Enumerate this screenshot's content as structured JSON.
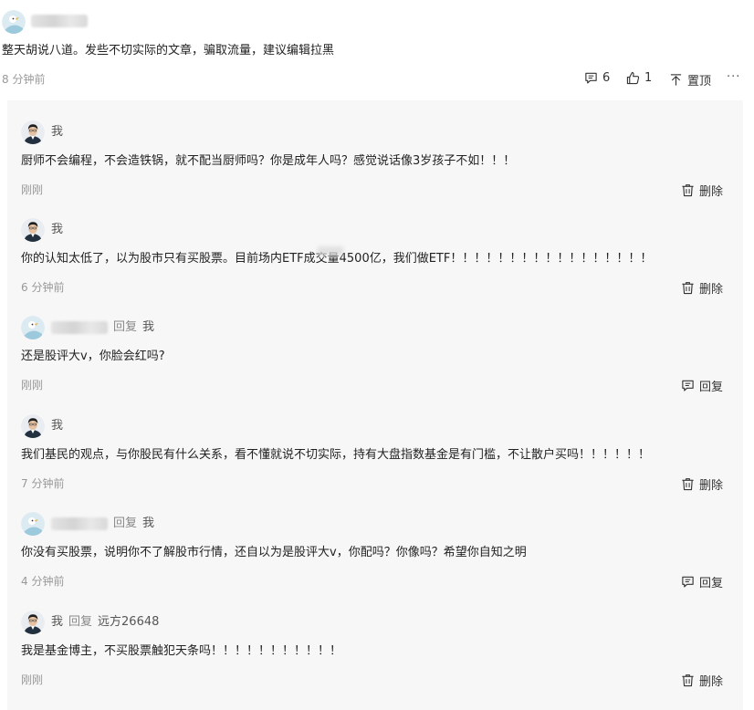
{
  "top_comment": {
    "text": "整天胡说八道。发些不切实际的文章，骗取流量，建议编辑拉黑",
    "time": "8 分钟前",
    "reply_count": "6",
    "like_count": "1",
    "pin_label": "置顶",
    "more_label": "···"
  },
  "replies": [
    {
      "author": "我",
      "reply_label": "",
      "reply_to": "",
      "text": "厨师不会编程，不会造铁锅，就不配当厨师吗？你是成年人吗？感觉说话像3岁孩子不如！！！",
      "time": "刚刚",
      "action": "删除"
    },
    {
      "author": "我",
      "reply_label": "",
      "reply_to": "",
      "text": "你的认知太低了，以为股市只有买股票。目前场内ETF成交量4500亿，我们做ETF！！！！！！！！！！！！！！！！！",
      "time": "6 分钟前",
      "action": "删除"
    },
    {
      "author": "",
      "reply_label": "回复",
      "reply_to": "我",
      "text": "还是股评大v，你脸会红吗?",
      "time": "刚刚",
      "action": "回复"
    },
    {
      "author": "我",
      "reply_label": "",
      "reply_to": "",
      "text": "我们基民的观点，与你股民有什么关系，看不懂就说不切实际，持有大盘指数基金是有门槛，不让散户买吗！！！！！！",
      "time": "7 分钟前",
      "action": "删除"
    },
    {
      "author": "",
      "reply_label": "回复",
      "reply_to": "我",
      "text": "你没有买股票，说明你不了解股市行情，还自以为是股评大v，你配吗？你像吗？希望你自知之明",
      "time": "4 分钟前",
      "action": "回复"
    },
    {
      "author": "我",
      "reply_label": "回复",
      "reply_to": "远方26648",
      "text": "我是基金博主，不买股票触犯天条吗！！！！！！！！！！！",
      "time": "刚刚",
      "action": "删除"
    }
  ]
}
